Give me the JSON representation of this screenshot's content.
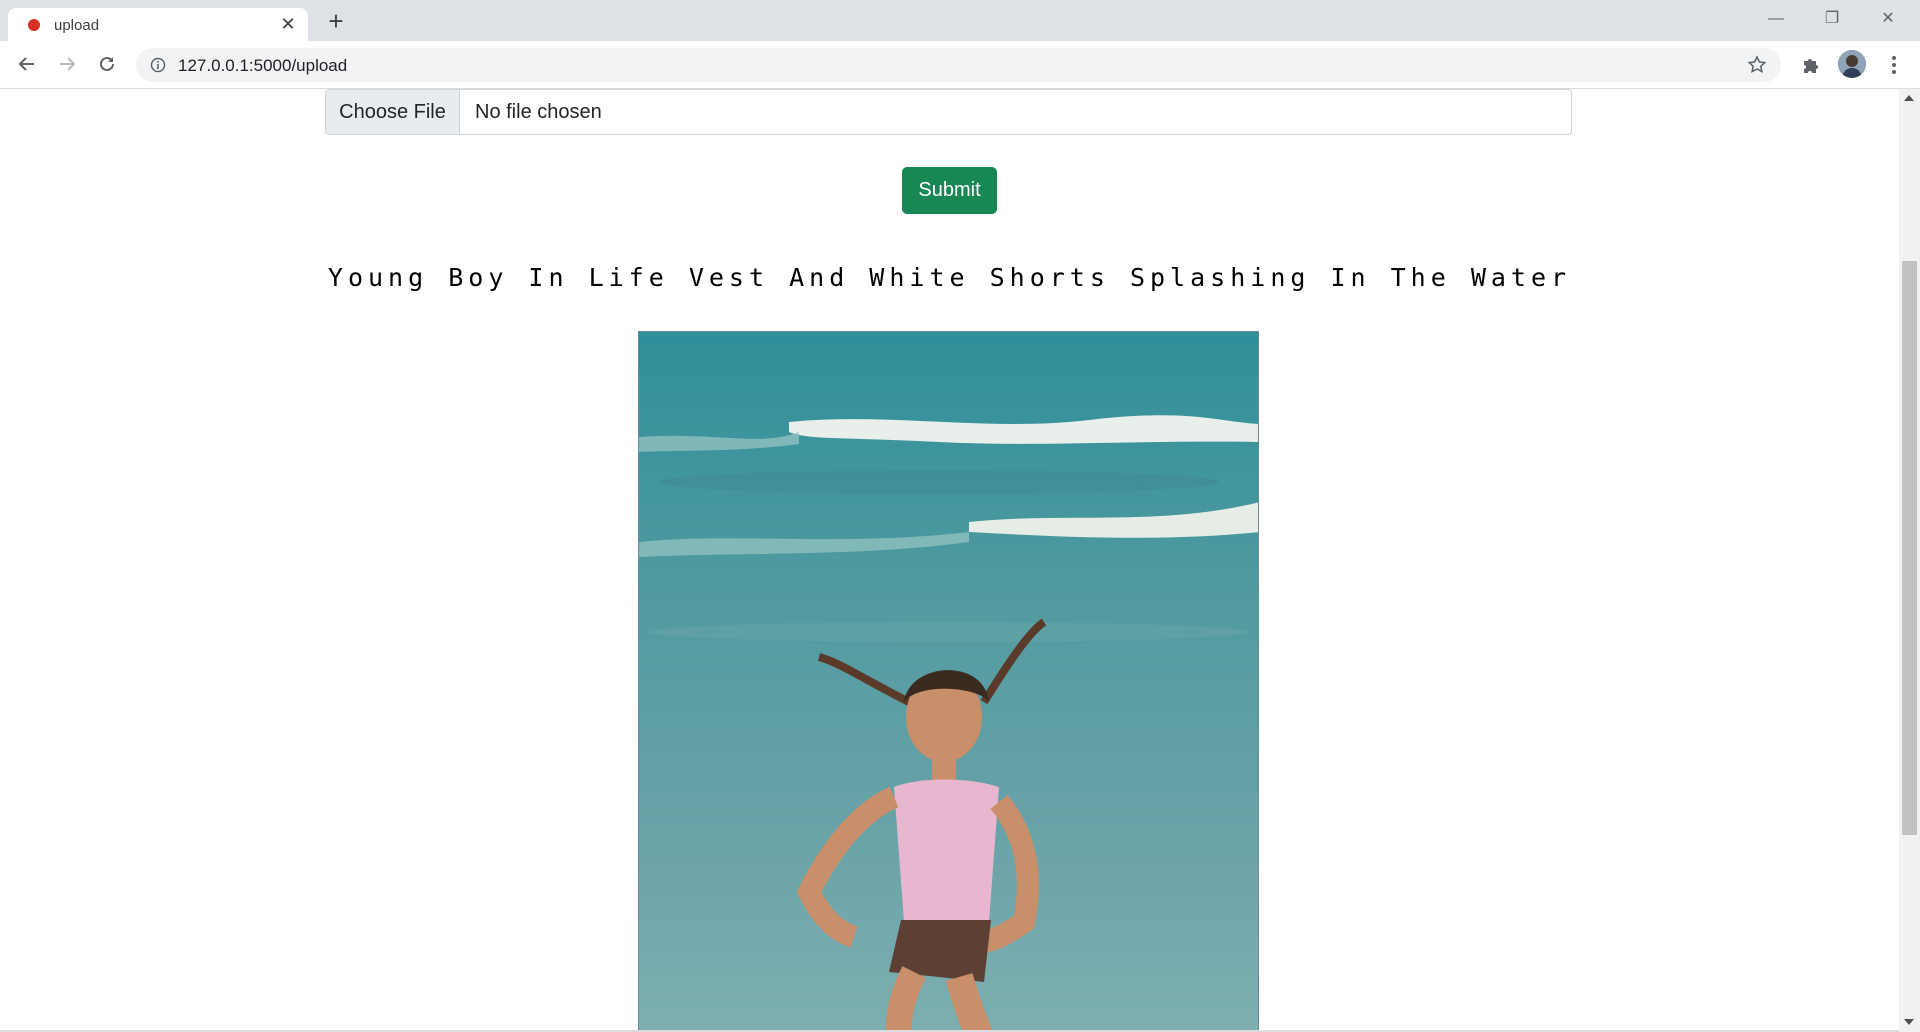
{
  "browser": {
    "tab_title": "upload",
    "url": "127.0.0.1:5000/upload",
    "icons": {
      "favicon": "record-dot-icon",
      "back": "arrow-left-icon",
      "forward": "arrow-right-icon",
      "reload": "reload-icon",
      "site_info": "info-icon",
      "bookmark": "star-icon",
      "extensions": "puzzle-icon",
      "menu": "kebab-menu-icon"
    }
  },
  "form": {
    "choose_file_label": "Choose File",
    "file_status": "No file chosen",
    "submit_label": "Submit",
    "submit_color": "#198754"
  },
  "result": {
    "caption": "Young Boy In Life Vest And White Shorts Splashing In The Water"
  }
}
